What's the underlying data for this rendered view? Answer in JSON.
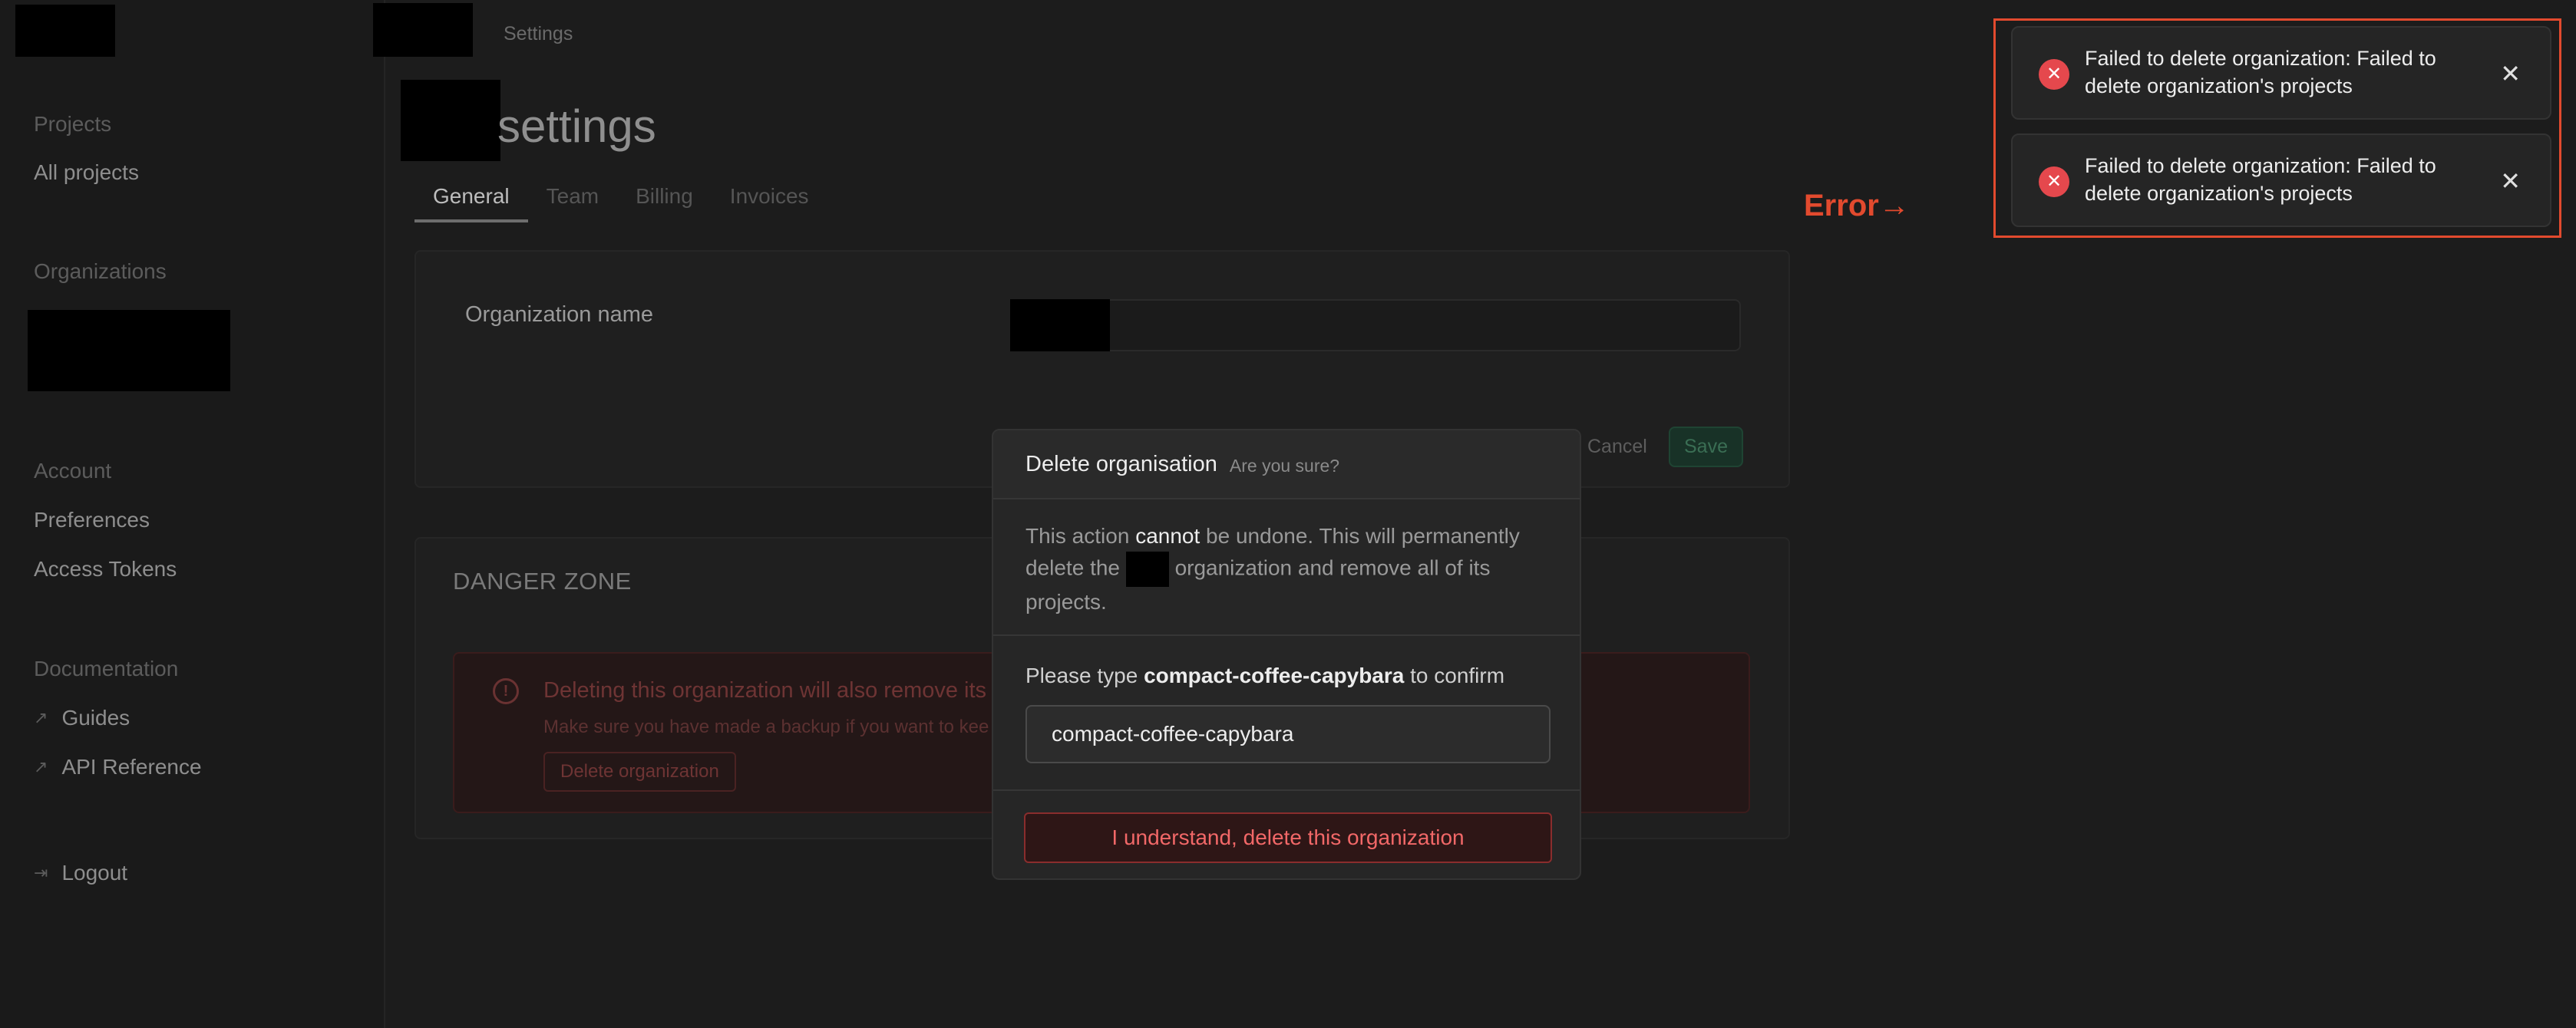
{
  "sidebar": {
    "sections": [
      {
        "title": "Projects",
        "items": [
          {
            "label": "All projects"
          }
        ]
      },
      {
        "title": "Organizations",
        "items": []
      },
      {
        "title": "Account",
        "items": [
          {
            "label": "Preferences"
          },
          {
            "label": "Access Tokens"
          }
        ]
      },
      {
        "title": "Documentation",
        "items": [
          {
            "label": "Guides",
            "icon": "external-link-icon"
          },
          {
            "label": "API Reference",
            "icon": "external-link-icon"
          }
        ]
      }
    ],
    "logout_label": "Logout"
  },
  "header": {
    "breadcrumb": "Settings"
  },
  "page": {
    "title": "settings",
    "tabs": [
      {
        "label": "General"
      },
      {
        "label": "Team"
      },
      {
        "label": "Billing"
      },
      {
        "label": "Invoices"
      }
    ],
    "general": {
      "org_name_label": "Organization name",
      "cancel_label": "Cancel",
      "save_label": "Save"
    },
    "danger_zone": {
      "title": "DANGER ZONE",
      "warning_heading": "Deleting this organization will also remove its p",
      "warning_text": "Make sure you have made a backup if you want to kee",
      "delete_button": "Delete organization"
    }
  },
  "modal": {
    "title": "Delete organisation",
    "subtitle": "Are you sure?",
    "body_prefix": "This action",
    "body_emphasis": "cannot",
    "body_mid": "be undone. This will permanently delete the",
    "body_suffix": "organization and remove all of its projects.",
    "confirm_prefix": "Please type",
    "confirm_code": "compact-coffee-capybara",
    "confirm_suffix": "to confirm",
    "input_value": "compact-coffee-capybara",
    "delete_button": "I understand, delete this organization"
  },
  "toasts": [
    {
      "message": "Failed to delete organization: Failed to delete organization's projects",
      "icon": "error-x-icon"
    },
    {
      "message": "Failed to delete organization: Failed to delete organization's projects",
      "icon": "error-x-icon"
    }
  ],
  "annotation": {
    "label": "Error→",
    "color": "#e24a2e"
  },
  "colors": {
    "error": "#e5484d",
    "danger_text": "#f26868",
    "background": "#1c1c1c"
  }
}
